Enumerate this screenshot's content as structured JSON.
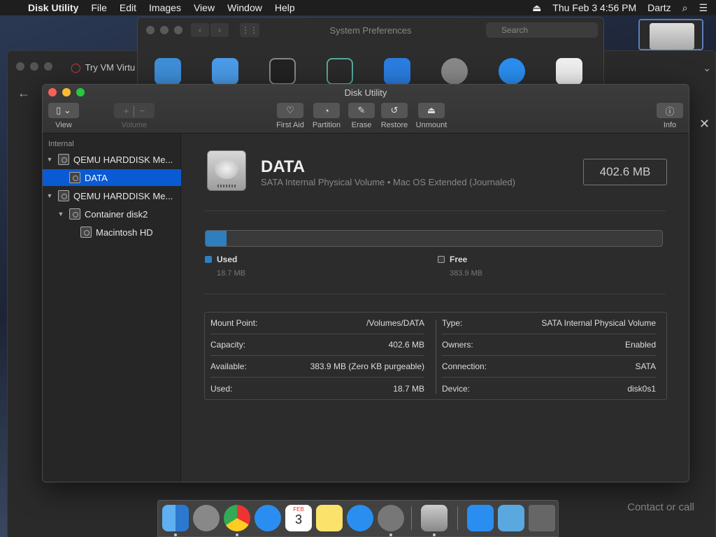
{
  "menubar": {
    "app_name": "Disk Utility",
    "items": [
      "File",
      "Edit",
      "Images",
      "View",
      "Window",
      "Help"
    ],
    "datetime": "Thu Feb 3  4:56 PM",
    "user": "Dartz"
  },
  "sysprefs": {
    "title": "System Preferences",
    "search_placeholder": "Search"
  },
  "browser": {
    "tab_title": "Try VM Virtu",
    "contact": "Contact or call"
  },
  "window": {
    "title": "Disk Utility"
  },
  "toolbar": {
    "view": "View",
    "volume": "Volume",
    "first_aid": "First Aid",
    "partition": "Partition",
    "erase": "Erase",
    "restore": "Restore",
    "unmount": "Unmount",
    "info": "Info"
  },
  "sidebar": {
    "section": "Internal",
    "items": [
      {
        "label": "QEMU HARDDISK Me..."
      },
      {
        "label": "DATA"
      },
      {
        "label": "QEMU HARDDISK Me..."
      },
      {
        "label": "Container disk2"
      },
      {
        "label": "Macintosh HD"
      }
    ]
  },
  "volume": {
    "name": "DATA",
    "subtitle": "SATA Internal Physical Volume • Mac OS Extended (Journaled)",
    "size": "402.6 MB",
    "used_fraction": 0.046,
    "used_label": "Used",
    "used_value": "18.7 MB",
    "free_label": "Free",
    "free_value": "383.9 MB",
    "used_color": "#2e7fbf",
    "free_color": "#3a3a3a"
  },
  "info": {
    "left": [
      {
        "label": "Mount Point:",
        "value": "/Volumes/DATA"
      },
      {
        "label": "Capacity:",
        "value": "402.6 MB"
      },
      {
        "label": "Available:",
        "value": "383.9 MB (Zero KB purgeable)"
      },
      {
        "label": "Used:",
        "value": "18.7 MB"
      }
    ],
    "right": [
      {
        "label": "Type:",
        "value": "SATA Internal Physical Volume"
      },
      {
        "label": "Owners:",
        "value": "Enabled"
      },
      {
        "label": "Connection:",
        "value": "SATA"
      },
      {
        "label": "Device:",
        "value": "disk0s1"
      }
    ]
  },
  "dock": {
    "apps": [
      "finder-icon",
      "launchpad-icon",
      "chrome-icon",
      "safari-icon",
      "calendar-icon",
      "notes-icon",
      "app-store-icon",
      "system-preferences-icon",
      "disk-utility-icon",
      "applications-folder-icon",
      "downloads-folder-icon",
      "trash-icon"
    ],
    "calendar_month": "FEB",
    "calendar_day": "3"
  }
}
